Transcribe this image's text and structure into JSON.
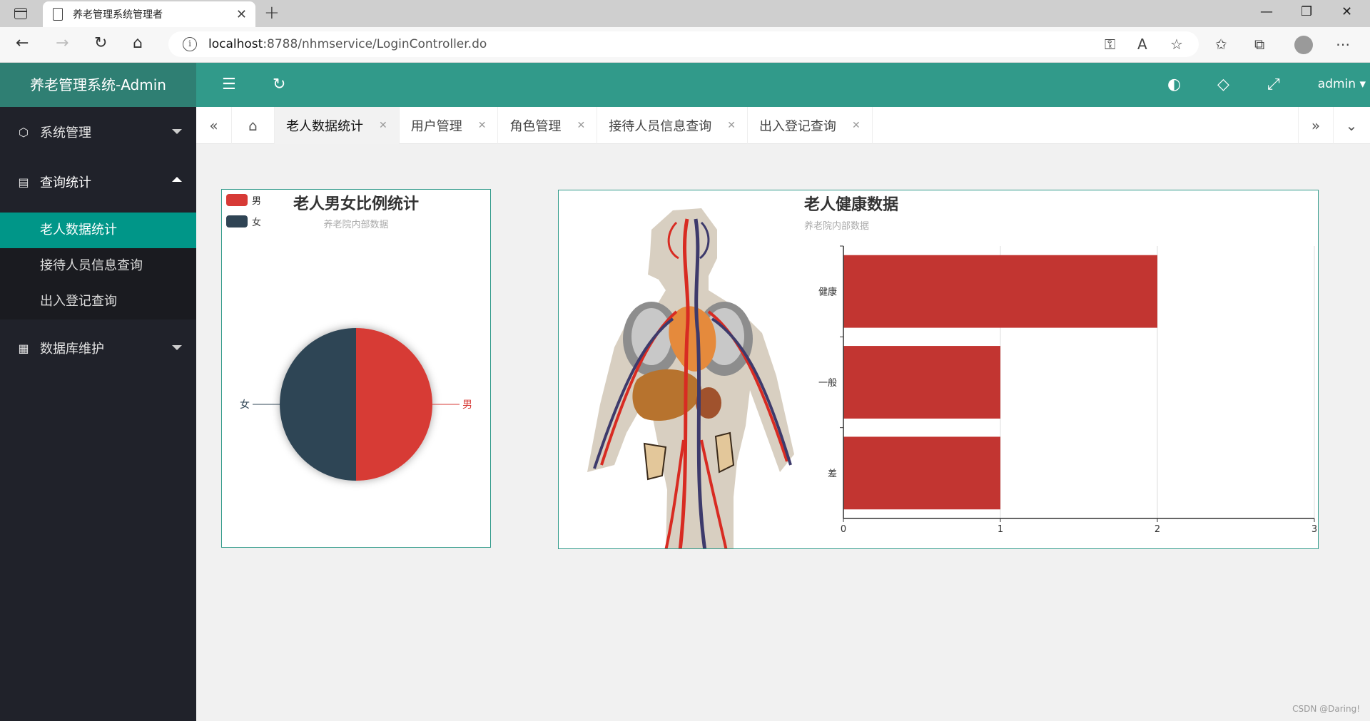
{
  "browser": {
    "tab_title": "养老管理系统管理者",
    "url_host": "localhost",
    "url_path": ":8788/nhmservice/LoginController.do"
  },
  "app": {
    "logo": "养老管理系统-Admin",
    "user": "admin"
  },
  "sidebar": {
    "items": [
      {
        "label": "系统管理",
        "icon": "cube-icon"
      },
      {
        "label": "查询统计",
        "icon": "report-icon"
      },
      {
        "label": "数据库维护",
        "icon": "apps-icon"
      }
    ],
    "sub_items": [
      "老人数据统计",
      "接待人员信息查询",
      "出入登记查询"
    ]
  },
  "tabs": [
    "老人数据统计",
    "用户管理",
    "角色管理",
    "接待人员信息查询",
    "出入登记查询"
  ],
  "chart_data": [
    {
      "type": "pie",
      "title": "老人男女比例统计",
      "subtitle": "养老院内部数据",
      "legend": [
        "男",
        "女"
      ],
      "categories": [
        "男",
        "女"
      ],
      "values": [
        1,
        1
      ],
      "colors": [
        "#d73a36",
        "#2f4454"
      ],
      "legend_position": "top-left"
    },
    {
      "type": "bar",
      "orientation": "horizontal",
      "title": "老人健康数据",
      "subtitle": "养老院内部数据",
      "categories": [
        "健康",
        "一般",
        "差"
      ],
      "values": [
        2,
        1,
        1
      ],
      "xlim": [
        0,
        3
      ],
      "xticks": [
        "0",
        "1",
        "2",
        "3"
      ],
      "color": "#c23531",
      "grid": true
    }
  ],
  "watermark": "CSDN @Daring!"
}
